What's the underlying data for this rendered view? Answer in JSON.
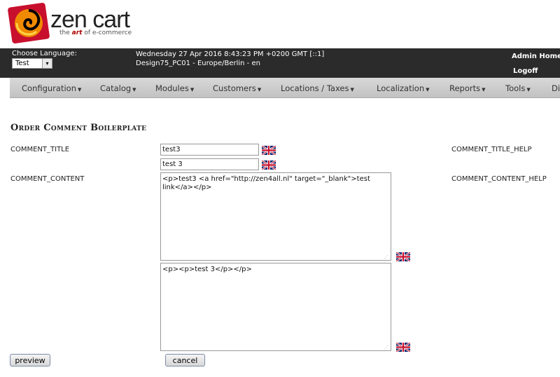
{
  "logo": {
    "brand": "zen cart",
    "tagline_pre": "the",
    "tagline_art": "art",
    "tagline_post": "of e-commerce"
  },
  "header": {
    "choose_language_label": "Choose Language:",
    "language_selected": "Test",
    "date_line": "Wednesday 27 Apr 2016 8:43:23 PM +0200 GMT [::1]",
    "store_line": "Design75_PC01 - Europe/Berlin - en",
    "admin_home": "Admin Home",
    "logoff": "Logoff"
  },
  "menu": [
    "Configuration",
    "Catalog",
    "Modules",
    "Customers",
    "Locations / Taxes",
    "Localization",
    "Reports",
    "Tools",
    "Dis"
  ],
  "page": {
    "title": "Order Comment Boilerplate",
    "comment_title_label": "COMMENT_TITLE",
    "comment_title_help": "COMMENT_TITLE_HELP",
    "comment_title_values": [
      "test3",
      "test 3"
    ],
    "comment_content_label": "COMMENT_CONTENT",
    "comment_content_help": "COMMENT_CONTENT_HELP",
    "comment_content_values": [
      "<p>test3 <a href=\"http://zen4all.nl\" target=\"_blank\">test link</a></p>",
      "<p><p>test 3</p></p>"
    ],
    "preview_button": "preview",
    "cancel_button": "cancel"
  },
  "icons": {
    "flag": "uk-flag-icon",
    "logo": "zen-cart-swirl-icon"
  },
  "colors": {
    "topbar": "#2b2b2b",
    "menubar": "#cccccc",
    "logo_orange": "#f08a00",
    "logo_red": "#c8102e"
  }
}
